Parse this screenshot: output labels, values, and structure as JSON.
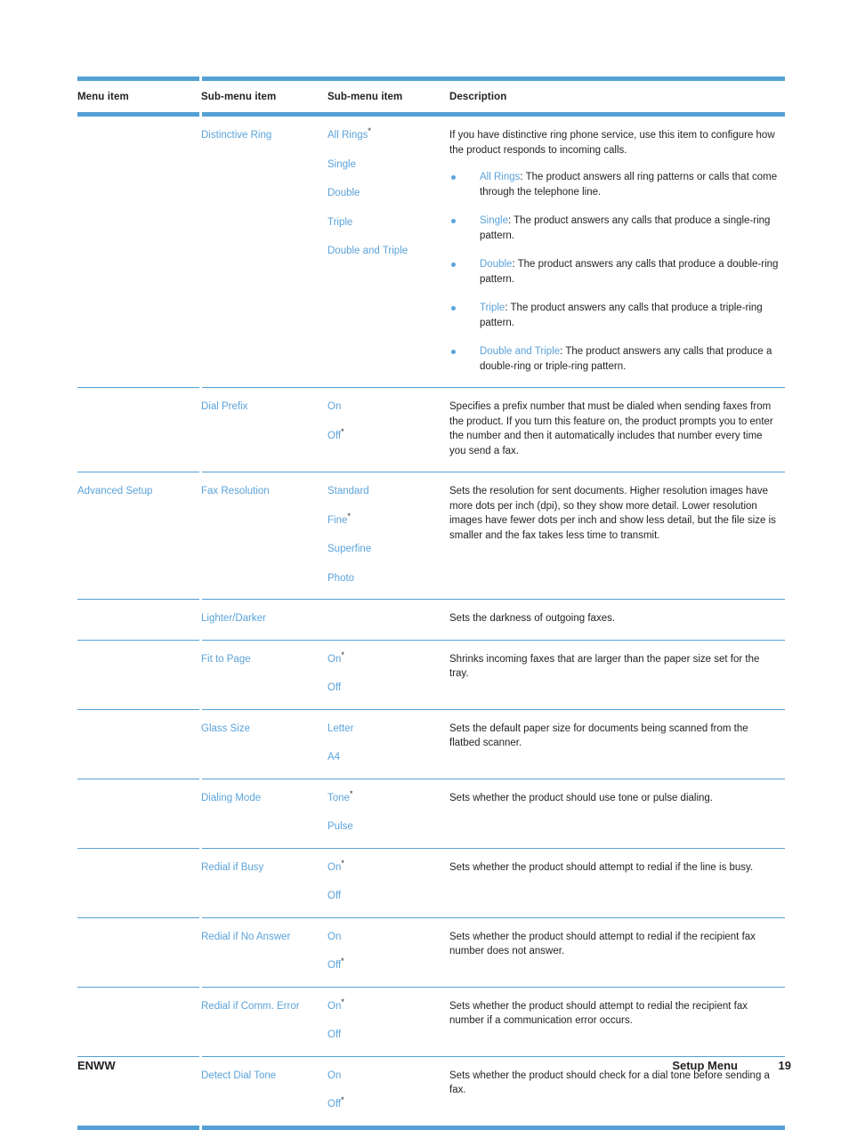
{
  "document": {
    "table": {
      "headers": [
        "Menu item",
        "Sub-menu item",
        "Sub-menu item",
        "Description"
      ],
      "rows": [
        {
          "menu_item": "",
          "sub_menu_1": "Distinctive Ring",
          "sub_menu_2": [
            "All Rings",
            "Single",
            "Double",
            "Triple",
            "Double and Triple"
          ],
          "sub_menu_2_default_index": 0,
          "description_intro": "If you have distinctive ring phone service, use this item to configure how the product responds to incoming calls.",
          "bullets": [
            {
              "term": "All Rings",
              "text": ": The product answers all ring patterns or calls that come through the telephone line."
            },
            {
              "term": "Single",
              "text": ": The product answers any calls that produce a single-ring pattern."
            },
            {
              "term": "Double",
              "text": ": The product answers any calls that produce a double-ring pattern."
            },
            {
              "term": "Triple",
              "text": ": The product answers any calls that produce a triple-ring pattern."
            },
            {
              "term": "Double and Triple",
              "text": ": The product answers any calls that produce a double-ring or triple-ring pattern."
            }
          ]
        },
        {
          "menu_item": "",
          "sub_menu_1": "Dial Prefix",
          "sub_menu_2": [
            "On",
            "Off"
          ],
          "sub_menu_2_default_index": 1,
          "description_intro": "Specifies a prefix number that must be dialed when sending faxes from the product. If you turn this feature on, the product prompts you to enter the number and then it automatically includes that number every time you send a fax.",
          "bullets": []
        },
        {
          "menu_item": "Advanced Setup",
          "sub_menu_1": "Fax Resolution",
          "sub_menu_2": [
            "Standard",
            "Fine",
            "Superfine",
            "Photo"
          ],
          "sub_menu_2_default_index": 1,
          "description_intro": "Sets the resolution for sent documents. Higher resolution images have more dots per inch (dpi), so they show more detail. Lower resolution images have fewer dots per inch and show less detail, but the file size is smaller and the fax takes less time to transmit.",
          "bullets": []
        },
        {
          "menu_item": "",
          "sub_menu_1": "Lighter/Darker",
          "sub_menu_2": [],
          "sub_menu_2_default_index": -1,
          "description_intro": "Sets the darkness of outgoing faxes.",
          "bullets": []
        },
        {
          "menu_item": "",
          "sub_menu_1": "Fit to Page",
          "sub_menu_2": [
            "On",
            "Off"
          ],
          "sub_menu_2_default_index": 0,
          "description_intro": "Shrinks incoming faxes that are larger than the paper size set for the tray.",
          "bullets": []
        },
        {
          "menu_item": "",
          "sub_menu_1": "Glass Size",
          "sub_menu_2": [
            "Letter",
            "A4"
          ],
          "sub_menu_2_default_index": -1,
          "description_intro": "Sets the default paper size for documents being scanned from the flatbed scanner.",
          "bullets": []
        },
        {
          "menu_item": "",
          "sub_menu_1": "Dialing Mode",
          "sub_menu_2": [
            "Tone",
            "Pulse"
          ],
          "sub_menu_2_default_index": 0,
          "description_intro": "Sets whether the product should use tone or pulse dialing.",
          "bullets": []
        },
        {
          "menu_item": "",
          "sub_menu_1": "Redial if Busy",
          "sub_menu_2": [
            "On",
            "Off"
          ],
          "sub_menu_2_default_index": 0,
          "description_intro": "Sets whether the product should attempt to redial if the line is busy.",
          "bullets": []
        },
        {
          "menu_item": "",
          "sub_menu_1": "Redial if No Answer",
          "sub_menu_2": [
            "On",
            "Off"
          ],
          "sub_menu_2_default_index": 1,
          "description_intro": "Sets whether the product should attempt to redial if the recipient fax number does not answer.",
          "bullets": []
        },
        {
          "menu_item": "",
          "sub_menu_1": "Redial if Comm. Error",
          "sub_menu_2": [
            "On",
            "Off"
          ],
          "sub_menu_2_default_index": 0,
          "description_intro": "Sets whether the product should attempt to redial the recipient fax number if a communication error occurs.",
          "bullets": []
        },
        {
          "menu_item": "",
          "sub_menu_1": "Detect Dial Tone",
          "sub_menu_2": [
            "On",
            "Off"
          ],
          "sub_menu_2_default_index": 1,
          "description_intro": "Sets whether the product should check for a dial tone before sending a fax.",
          "bullets": []
        }
      ]
    },
    "footer": {
      "left": "ENWW",
      "chapter": "Setup Menu",
      "page_number": "19"
    },
    "colors": {
      "link_blue": "#5ba3da",
      "rule_blue": "#55a0d4",
      "text_black": "#231f20"
    }
  }
}
